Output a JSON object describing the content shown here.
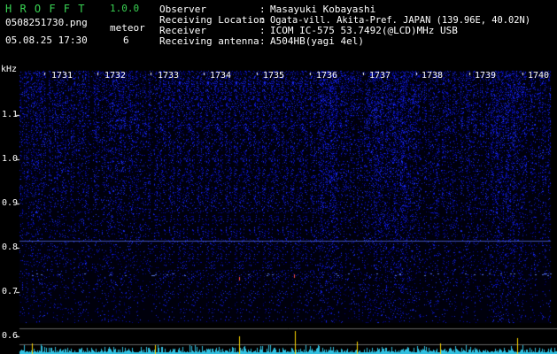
{
  "app": {
    "name": "H R O F F T",
    "version": "1.0.0",
    "filename": "0508251730.png",
    "datetime": "05.08.25 17:30",
    "meteor_label": "meteor",
    "meteor_count": "6"
  },
  "info": {
    "labels": [
      "Observer",
      "Receiving Location",
      "Receiver",
      "Receiving antenna"
    ],
    "separator": ":",
    "values": [
      "Masayuki Kobayashi",
      "Ogata-vill. Akita-Pref. JAPAN (139.96E, 40.02N)",
      "ICOM IC-575 53.7492(@LCD)MHz USB",
      "A504HB(yagi 4el)"
    ]
  },
  "spectrogram": {
    "y_unit": "kHz",
    "y_ticks": [
      "1.1",
      "1.0",
      "0.9",
      "0.8",
      "0.7",
      "0.6"
    ],
    "minute_labels": [
      "1731",
      "1732",
      "1733",
      "1734",
      "1735",
      "1736",
      "1737",
      "1738",
      "1739",
      "1740"
    ],
    "colors": {
      "background": "#000010",
      "noise": "#1e32c8",
      "meteor": "#ffd800",
      "spectrum": "#30c0e0",
      "labels": "#39d353"
    }
  }
}
